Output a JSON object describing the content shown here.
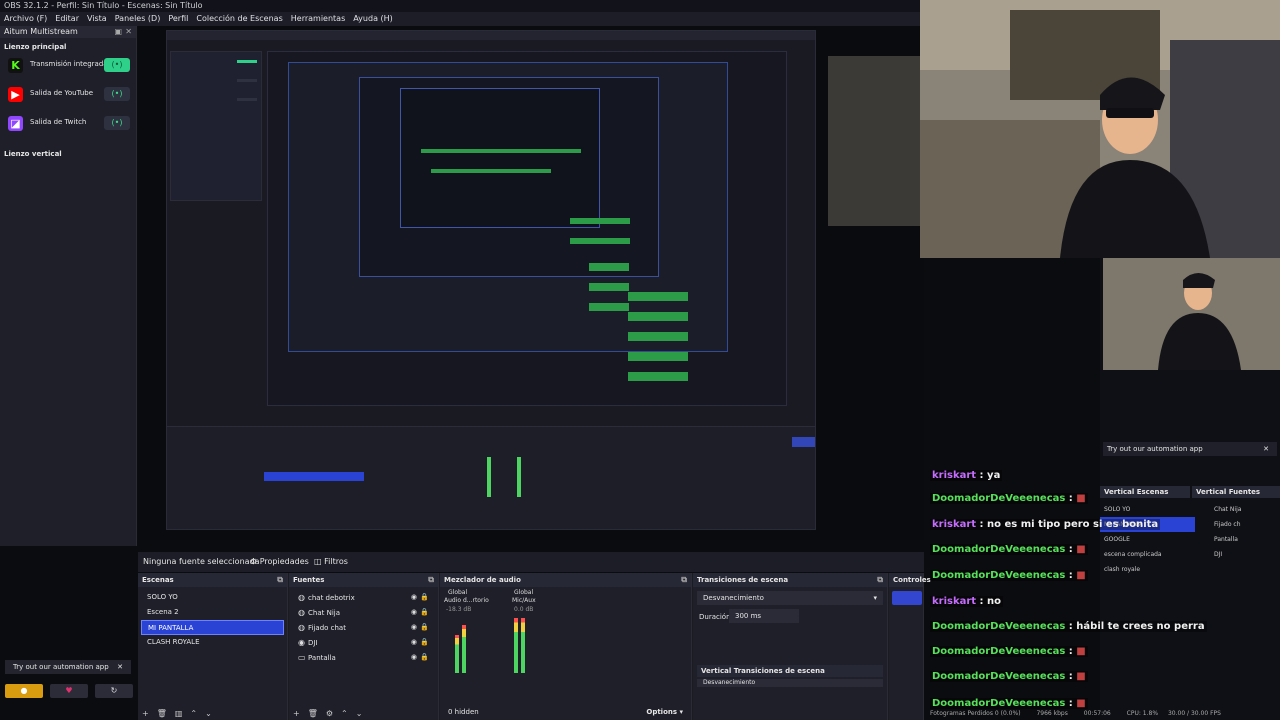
{
  "window": {
    "title": "OBS 32.1.2 - Perfil: Sin Título - Escenas: Sin Título"
  },
  "menu": [
    "Archivo (F)",
    "Editar",
    "Vista",
    "Paneles (D)",
    "Perfil",
    "Colección de Escenas",
    "Herramientas",
    "Ayuda (H)"
  ],
  "multistream": {
    "title": "Aitum Multistream",
    "main_canvas": "Lienzo principal",
    "vertical_canvas": "Lienzo vertical",
    "outputs": [
      {
        "label": "Transmisión integrada",
        "icon": "kick-icon",
        "color": "#53fc18"
      },
      {
        "label": "Salida de YouTube",
        "icon": "youtube-icon",
        "color": "#ff0000"
      },
      {
        "label": "Salida de Twitch",
        "icon": "twitch-icon",
        "color": "#9146ff"
      }
    ]
  },
  "props_bar": {
    "no_source": "Ninguna fuente seleccionada",
    "properties": "Propiedades",
    "filters": "Filtros"
  },
  "scenes": {
    "title": "Escenas",
    "items": [
      "SOLO YO",
      "Escena 2",
      "MI PANTALLA",
      "CLASH ROYALE"
    ],
    "selected": "MI PANTALLA"
  },
  "sources": {
    "title": "Fuentes",
    "items": [
      {
        "label": "chat debotrix",
        "icon": "globe-icon"
      },
      {
        "label": "Chat Nija",
        "icon": "globe-icon"
      },
      {
        "label": "Fijado chat",
        "icon": "globe-icon"
      },
      {
        "label": "DJI",
        "icon": "camera-icon"
      },
      {
        "label": "Pantalla",
        "icon": "monitor-icon"
      }
    ]
  },
  "mixer": {
    "title": "Mezclador de audio",
    "ch1_label": "Global",
    "ch1_name": "Audio d...rtorio",
    "ch1_db": "-18.3 dB",
    "ch2_label": "Global",
    "ch2_name": "Mic/Aux",
    "ch2_db": "0.0 dB",
    "hidden": "0 hidden",
    "options": "Options"
  },
  "transitions": {
    "title": "Transiciones de escena",
    "type": "Desvanecimiento",
    "duration_label": "Duración",
    "duration_value": "300 ms",
    "vertical_title": "Vertical Transiciones de escena",
    "vertical_type": "Desvanecimiento"
  },
  "controls": {
    "title": "Controles"
  },
  "automation": {
    "label": "Try out our automation app"
  },
  "chat": [
    {
      "user": "kriskart",
      "text": "ya",
      "color": "#c66cff"
    },
    {
      "user": "DoomadorDeVeeenecas",
      "text": "",
      "color": "#57e05a"
    },
    {
      "user": "kriskart",
      "text": "no es mi tipo pero si es bonita",
      "color": "#c66cff"
    },
    {
      "user": "DoomadorDeVeeenecas",
      "text": "",
      "color": "#57e05a"
    },
    {
      "user": "DoomadorDeVeeenecas",
      "text": "",
      "color": "#57e05a"
    },
    {
      "user": "kriskart",
      "text": "no",
      "color": "#c66cff"
    },
    {
      "user": "DoomadorDeVeeenecas",
      "text": "hábil te crees no perra",
      "color": "#57e05a"
    },
    {
      "user": "DoomadorDeVeeenecas",
      "text": "",
      "color": "#57e05a"
    },
    {
      "user": "DoomadorDeVeeenecas",
      "text": "",
      "color": "#57e05a"
    },
    {
      "user": "DoomadorDeVeeenecas",
      "text": "",
      "color": "#57e05a"
    }
  ],
  "vertical": {
    "scenes_title": "Vertical Escenas",
    "sources_title": "Vertical Fuentes",
    "scenes": [
      "SOLO YO",
      "MI PANTALLA",
      "GOOGLE",
      "escena complicada",
      "clash royale"
    ],
    "sources": [
      "Chat Nija",
      "Fijado ch",
      "Pantalla",
      "DJI"
    ]
  },
  "status": {
    "text": "Fotogramas Perdidos 0 (0.0%)",
    "kbps": "7966 kbps",
    "time": "00:57:06",
    "cpu": "CPU: 1.8%",
    "fps": "30.00 / 30.00 FPS"
  }
}
